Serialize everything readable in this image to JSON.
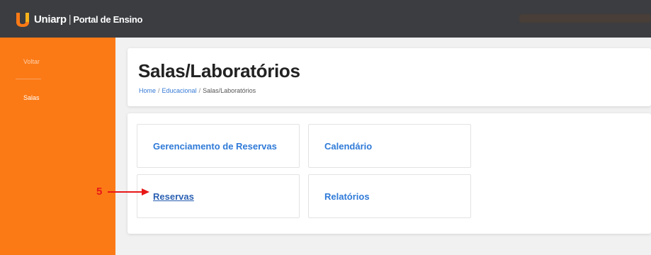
{
  "topbar": {
    "brand_name": "Uniarp",
    "separator": "|",
    "portal_name": "Portal de Ensino",
    "logo_icon": "uniarp-logo-icon"
  },
  "sidebar": {
    "items": [
      {
        "label": "Voltar"
      },
      {
        "label": "Salas"
      }
    ]
  },
  "header": {
    "title": "Salas/Laboratórios",
    "breadcrumb": [
      "Home",
      "Educacional",
      "Salas/Laboratórios"
    ],
    "breadcrumb_separator": "/"
  },
  "tiles": [
    {
      "label": "Gerenciamento de Reservas"
    },
    {
      "label": "Calendário"
    },
    {
      "label": "Reservas"
    },
    {
      "label": "Relatórios"
    }
  ],
  "annotation": {
    "number": "5",
    "color": "#e81717"
  },
  "colors": {
    "topbar": "#3b3d41",
    "sidebar": "#fb7a16",
    "link": "#2f7ad8"
  }
}
